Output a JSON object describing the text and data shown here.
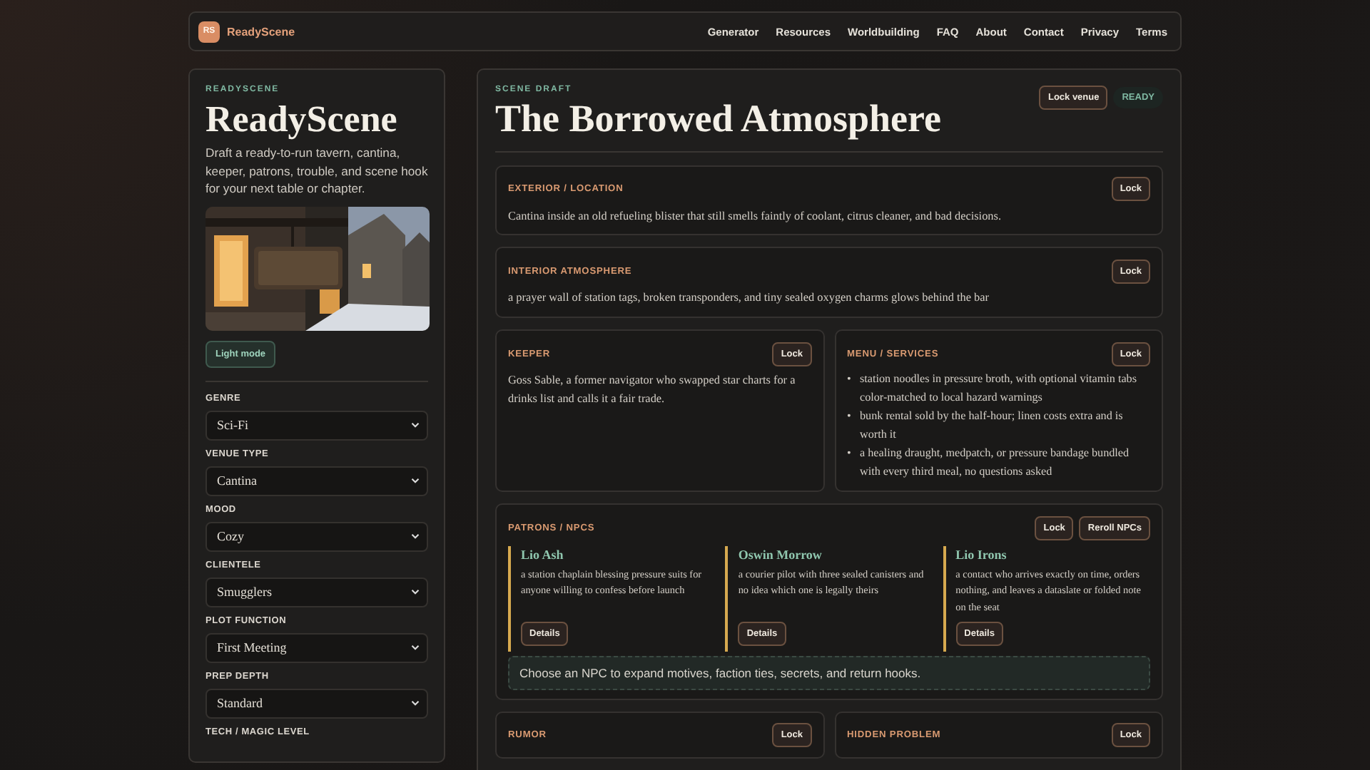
{
  "nav": {
    "logo": "RS",
    "brand": "ReadyScene",
    "links": [
      "Generator",
      "Resources",
      "Worldbuilding",
      "FAQ",
      "About",
      "Contact",
      "Privacy",
      "Terms"
    ]
  },
  "sidebar": {
    "eyebrow": "READYSCENE",
    "title": "ReadyScene",
    "description": "Draft a ready-to-run tavern, cantina, keeper, patrons, trouble, and scene hook for your next table or chapter.",
    "theme_button": "Light mode",
    "fields": [
      {
        "label": "GENRE",
        "value": "Sci-Fi"
      },
      {
        "label": "VENUE TYPE",
        "value": "Cantina"
      },
      {
        "label": "MOOD",
        "value": "Cozy"
      },
      {
        "label": "CLIENTELE",
        "value": "Smugglers"
      },
      {
        "label": "PLOT FUNCTION",
        "value": "First Meeting"
      },
      {
        "label": "PREP DEPTH",
        "value": "Standard"
      },
      {
        "label": "TECH / MAGIC LEVEL"
      }
    ]
  },
  "main": {
    "eyebrow": "SCENE DRAFT",
    "title": "The Borrowed Atmosphere",
    "lock_button": "Lock venue",
    "status": "READY",
    "rows": [
      {
        "sections": [
          {
            "kind": "text",
            "heading": "EXTERIOR / LOCATION",
            "buttons": [
              "Lock"
            ],
            "text": "Cantina inside an old refueling blister that still smells faintly of coolant, citrus cleaner, and bad decisions."
          }
        ]
      },
      {
        "sections": [
          {
            "kind": "text",
            "heading": "INTERIOR ATMOSPHERE",
            "buttons": [
              "Lock"
            ],
            "text": "a prayer wall of station tags, broken transponders, and tiny sealed oxygen charms glows behind the bar"
          }
        ]
      },
      {
        "sections": [
          {
            "kind": "text",
            "heading": "KEEPER",
            "buttons": [
              "Lock"
            ],
            "text": "Goss Sable, a former navigator who swapped star charts for a drinks list and calls it a fair trade."
          },
          {
            "kind": "list",
            "heading": "MENU / SERVICES",
            "buttons": [
              "Lock"
            ],
            "marker": "•",
            "items": [
              "station noodles in pressure broth, with optional vitamin tabs color-matched to local hazard warnings",
              "bunk rental sold by the half-hour; linen costs extra and is worth it",
              "a healing draught, medpatch, or pressure bandage bundled with every third meal, no questions asked"
            ]
          }
        ]
      },
      {
        "sections": [
          {
            "kind": "npcs",
            "heading": "PATRONS / NPCS",
            "buttons": [
              "Lock",
              "Reroll NPCs"
            ],
            "npcs": [
              {
                "name": "Lio Ash",
                "text": "a station chaplain blessing pressure suits for anyone willing to confess before launch",
                "button": "Details"
              },
              {
                "name": "Oswin Morrow",
                "text": "a courier pilot with three sealed canisters and no idea which one is legally theirs",
                "button": "Details"
              },
              {
                "name": "Lio Irons",
                "text": "a contact who arrives exactly on time, orders nothing, and leaves a dataslate or folded note on the seat",
                "button": "Details"
              }
            ],
            "hint": "Choose an NPC to expand motives, faction ties, secrets, and return hooks."
          }
        ]
      },
      {
        "sections": [
          {
            "kind": "text",
            "heading": "RUMOR",
            "buttons": [
              "Lock"
            ]
          },
          {
            "kind": "text",
            "heading": "HIDDEN PROBLEM",
            "buttons": [
              "Lock"
            ]
          }
        ]
      }
    ]
  }
}
